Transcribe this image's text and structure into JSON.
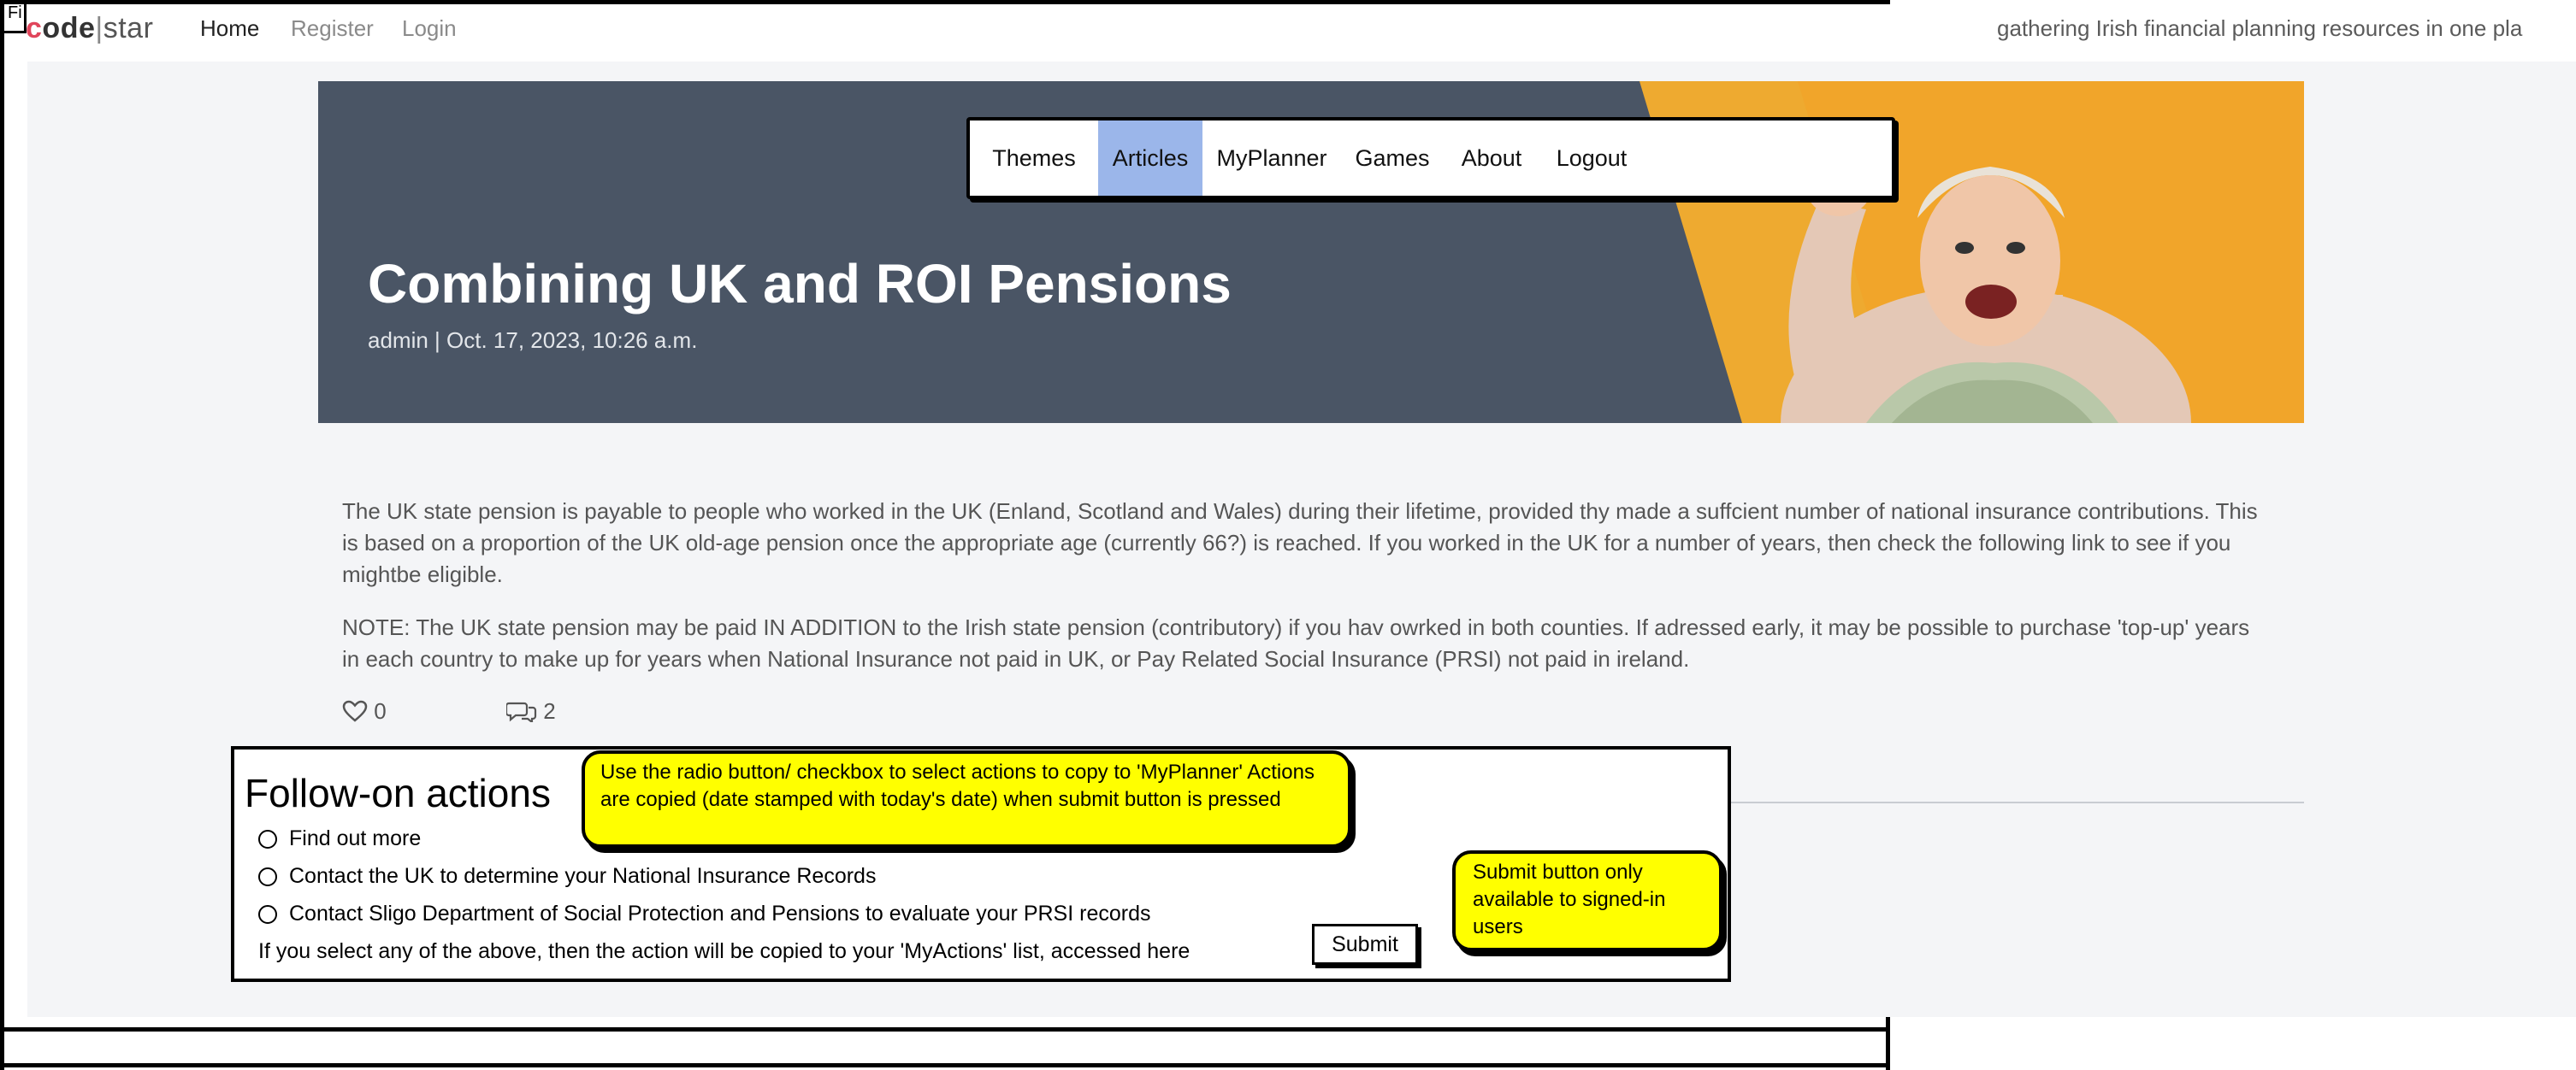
{
  "brand": {
    "logo_c": "c",
    "logo_rest": "ode",
    "logo_bar": "|",
    "logo_star": "star"
  },
  "corner_mark": "Fi",
  "topnav": {
    "home": "Home",
    "register": "Register",
    "login": "Login"
  },
  "tagline": "gathering Irish financial planning resources in one pla",
  "menu": [
    "Themes",
    "Articles",
    "MyPlanner",
    "Games",
    "About",
    "Logout"
  ],
  "menu_active": "Articles",
  "article": {
    "title": "Combining UK and ROI Pensions",
    "meta": "admin | Oct. 17, 2023, 10:26 a.m.",
    "para1": "The UK state pension is payable to people who worked in the UK (Enland, Scotland and Wales) during their lifetime, provided thy made a suffcient number of national insurance contributions.  This is based on a proportion of the UK old-age pension once the appropriate age (currently 66?) is reached.  If you worked in the UK for a number of years, then check the following link to see if you mightbe eligible.",
    "para2": "NOTE:  The UK state pension may be paid IN ADDITION to the Irish state pension (contributory) if you hav owrked in both counties.  If adressed early, it may be possible to purchase 'top-up' years in each country to make up for years when National Insurance not paid in UK, or Pay Related Social Insurance (PRSI) not paid in ireland.",
    "likes": "0",
    "comments": "2"
  },
  "follow_on": {
    "title": "Follow-on actions",
    "options": [
      "Find out more",
      "Contact the UK to determine your National Insurance Records",
      "Contact Sligo Department of Social Protection and Pensions to evaluate your PRSI records"
    ],
    "note": "If you select any of the above, then the action will be copied to your 'MyActions' list, accessed here",
    "submit_label": "Submit"
  },
  "annotations": {
    "radio_help": "Use the radio button/ checkbox to select actions to copy to 'MyPlanner' Actions are copied (date stamped with today's date) when submit button is pressed",
    "submit_help": "Submit button only available to signed-in users"
  },
  "colors": {
    "accent_active_menu": "#9bb6ea",
    "hero_dark": "#4a5565",
    "hero_orange": "#f1a52a",
    "sticky_note": "#ffff00",
    "logo_red": "#e0455b"
  }
}
